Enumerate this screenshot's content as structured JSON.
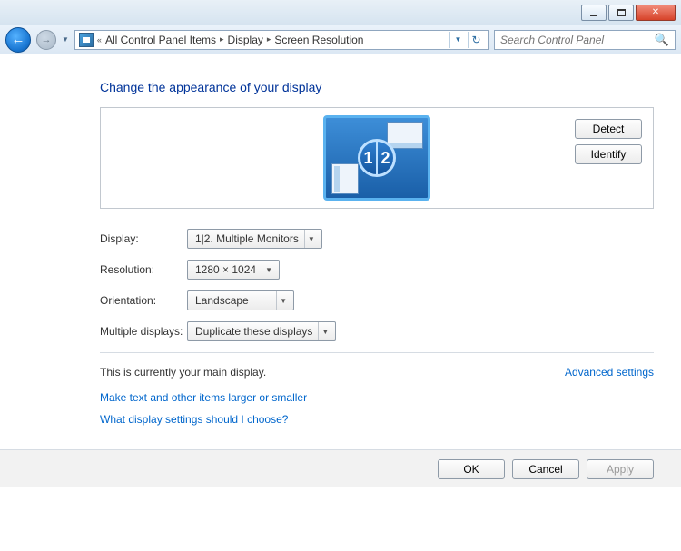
{
  "titlebar": {
    "minimize": "Minimize",
    "maximize": "Maximize",
    "close": "Close"
  },
  "nav": {
    "crumbs": [
      "All Control Panel Items",
      "Display",
      "Screen Resolution"
    ],
    "search_placeholder": "Search Control Panel"
  },
  "heading": "Change the appearance of your display",
  "preview": {
    "detect": "Detect",
    "identify": "Identify",
    "badge_left": "1",
    "badge_right": "2"
  },
  "form": {
    "display_label": "Display:",
    "display_value": "1|2. Multiple Monitors",
    "resolution_label": "Resolution:",
    "resolution_value": "1280 × 1024",
    "orientation_label": "Orientation:",
    "orientation_value": "Landscape",
    "multiple_label": "Multiple displays:",
    "multiple_value": "Duplicate these displays"
  },
  "notes": {
    "main_display": "This is currently your main display.",
    "advanced": "Advanced settings",
    "link1": "Make text and other items larger or smaller",
    "link2": "What display settings should I choose?"
  },
  "footer": {
    "ok": "OK",
    "cancel": "Cancel",
    "apply": "Apply"
  }
}
